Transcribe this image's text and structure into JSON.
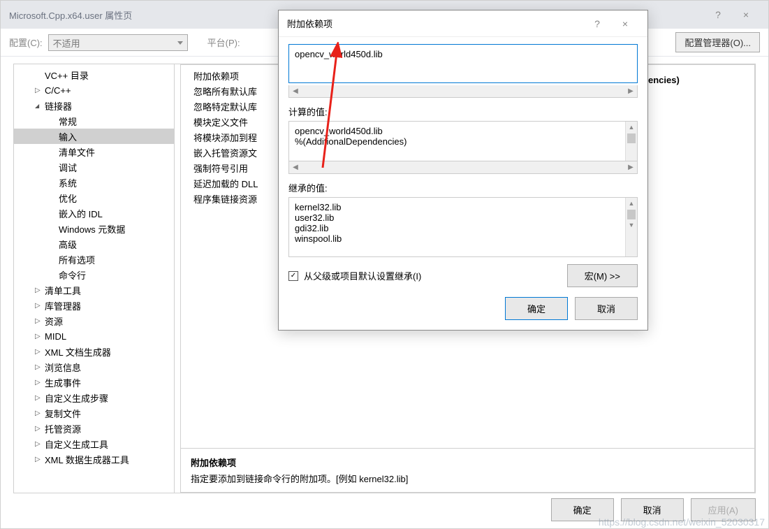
{
  "parentWindow": {
    "title": "Microsoft.Cpp.x64.user 属性页",
    "help": "?",
    "close": "×"
  },
  "configRow": {
    "configLabel": "配置(C):",
    "configValue": "不适用",
    "platformLabel": "平台(P):",
    "configMgrBtn": "配置管理器(O)..."
  },
  "tree": {
    "items": [
      {
        "label": "VC++ 目录",
        "level": 1,
        "arrow": ""
      },
      {
        "label": "C/C++",
        "level": 1,
        "arrow": "closed"
      },
      {
        "label": "链接器",
        "level": 1,
        "arrow": "open"
      },
      {
        "label": "常规",
        "level": 2
      },
      {
        "label": "输入",
        "level": 2,
        "selected": true
      },
      {
        "label": "清单文件",
        "level": 2
      },
      {
        "label": "调试",
        "level": 2
      },
      {
        "label": "系统",
        "level": 2
      },
      {
        "label": "优化",
        "level": 2
      },
      {
        "label": "嵌入的 IDL",
        "level": 2
      },
      {
        "label": "Windows 元数据",
        "level": 2
      },
      {
        "label": "高级",
        "level": 2
      },
      {
        "label": "所有选项",
        "level": 2
      },
      {
        "label": "命令行",
        "level": 2
      },
      {
        "label": "清单工具",
        "level": 1,
        "arrow": "closed"
      },
      {
        "label": "库管理器",
        "level": 1,
        "arrow": "closed"
      },
      {
        "label": "资源",
        "level": 1,
        "arrow": "closed"
      },
      {
        "label": "MIDL",
        "level": 1,
        "arrow": "closed"
      },
      {
        "label": "XML 文档生成器",
        "level": 1,
        "arrow": "closed"
      },
      {
        "label": "浏览信息",
        "level": 1,
        "arrow": "closed"
      },
      {
        "label": "生成事件",
        "level": 1,
        "arrow": "closed"
      },
      {
        "label": "自定义生成步骤",
        "level": 1,
        "arrow": "closed"
      },
      {
        "label": "复制文件",
        "level": 1,
        "arrow": "closed"
      },
      {
        "label": "托管资源",
        "level": 1,
        "arrow": "closed"
      },
      {
        "label": "自定义生成工具",
        "level": 1,
        "arrow": "closed"
      },
      {
        "label": "XML 数据生成器工具",
        "level": 1,
        "arrow": "closed"
      }
    ]
  },
  "props": [
    "附加依赖项",
    "忽略所有默认库",
    "忽略特定默认库",
    "模块定义文件",
    "将模块添加到程",
    "嵌入托管资源文",
    "强制符号引用",
    "延迟加载的 DLL",
    "程序集链接资源"
  ],
  "enciesPeek": "encies)",
  "desc": {
    "title": "附加依赖项",
    "text": "指定要添加到链接命令行的附加项。[例如 kernel32.lib]"
  },
  "bottomButtons": {
    "ok": "确定",
    "cancel": "取消",
    "apply": "应用(A)"
  },
  "modal": {
    "title": "附加依赖项",
    "help": "?",
    "close": "×",
    "inputValue": "opencv_world450d.lib",
    "computedLabel": "计算的值:",
    "computedLines": [
      "opencv_world450d.lib",
      "%(AdditionalDependencies)"
    ],
    "inheritedLabel": "继承的值:",
    "inheritedLines": [
      "kernel32.lib",
      "user32.lib",
      "gdi32.lib",
      "winspool.lib"
    ],
    "inheritCheckboxLabel": "从父级或项目默认设置继承(I)",
    "inheritChecked": true,
    "macroBtn": "宏(M) >>",
    "ok": "确定",
    "cancel": "取消"
  },
  "watermark": "https://blog.csdn.net/weixin_52030317"
}
